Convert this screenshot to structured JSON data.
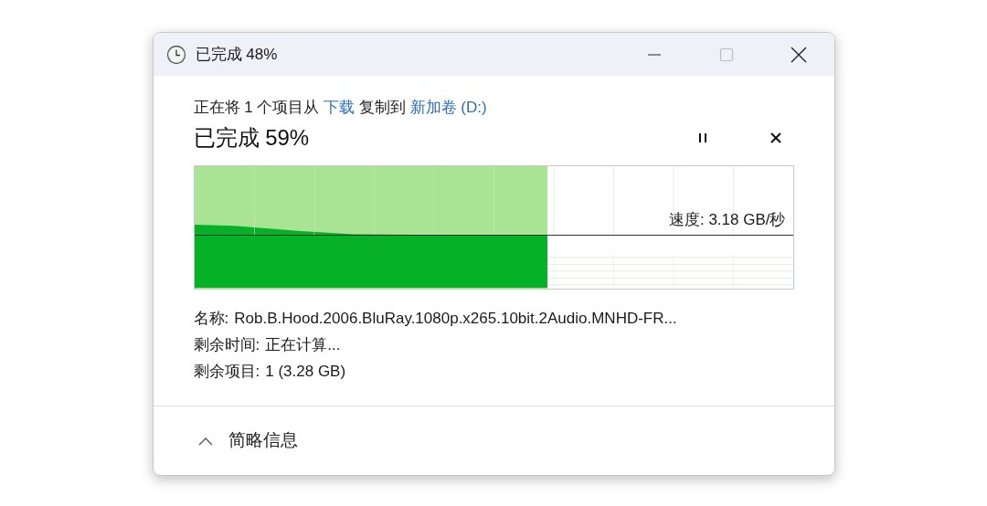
{
  "window": {
    "title": "已完成 48%"
  },
  "copy_line": [
    {
      "kind": "text",
      "text": "正在将 1 个项目从"
    },
    {
      "kind": "link",
      "text": "下载"
    },
    {
      "kind": "text",
      "text": "复制到"
    },
    {
      "kind": "link",
      "text": "新加卷 (D:)"
    }
  ],
  "progress": {
    "heading": "已完成 59%",
    "level": 0.59,
    "speed": "速度: 3.18 GB/秒"
  },
  "details": [
    {
      "label": "名称:",
      "value": "Rob.B.Hood.2006.BluRay.1080p.x265.10bit.2Audio.MNHD-FR..."
    },
    {
      "label": "剩余时间:",
      "value": "正在计算..."
    },
    {
      "label": "剩余项目:",
      "value": "1 (3.28 GB)"
    }
  ],
  "footer": {
    "label": "简略信息",
    "expanded": true
  }
}
